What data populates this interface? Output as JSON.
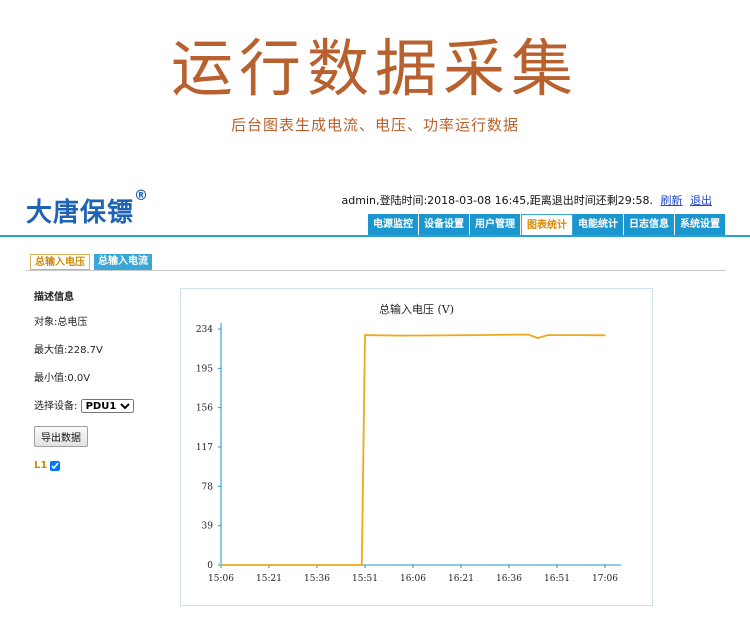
{
  "banner": {
    "title": "运行数据采集",
    "subtitle": "后台图表生成电流、电压、功率运行数据"
  },
  "app": {
    "logo_text": "大唐保镖",
    "logo_mark": "®",
    "userbar": {
      "status": "admin,登陆时间:2018-03-08 16:45,距离退出时间还剩29:58.",
      "refresh": "刷新",
      "logout": "退出"
    },
    "nav": [
      {
        "label": "电源监控",
        "active": false
      },
      {
        "label": "设备设置",
        "active": false
      },
      {
        "label": "用户管理",
        "active": false
      },
      {
        "label": "图表统计",
        "active": true
      },
      {
        "label": "电能统计",
        "active": false
      },
      {
        "label": "日志信息",
        "active": false
      },
      {
        "label": "系统设置",
        "active": false
      }
    ],
    "subtabs": [
      {
        "label": "总输入电压",
        "active": true
      },
      {
        "label": "总输入电流",
        "active": false
      }
    ],
    "side": {
      "heading": "描述信息",
      "object": "对象:总电压",
      "max": "最大值:228.7V",
      "min": "最小值:0.0V",
      "select_label": "选择设备:",
      "select_value": "PDU1",
      "export_button": "导出数据",
      "legend_label": "L1",
      "legend_checked": true
    },
    "colors": {
      "accent": "#1b96cf",
      "series": "#f0a818",
      "banner": "#b8612e"
    }
  },
  "chart_data": {
    "type": "line",
    "title": "总输入电压 (V)",
    "xlabel": "",
    "ylabel": "",
    "x_ticks": [
      "15:06",
      "15:21",
      "15:36",
      "15:51",
      "16:06",
      "16:21",
      "16:36",
      "16:51",
      "17:06"
    ],
    "x_range_minutes": [
      0,
      60
    ],
    "y_ticks": [
      0,
      39,
      78,
      117,
      156,
      195,
      234
    ],
    "ylim": [
      0,
      234
    ],
    "grid": false,
    "series": [
      {
        "name": "L1",
        "points": [
          {
            "x": 0,
            "y": 0
          },
          {
            "x": 22,
            "y": 0
          },
          {
            "x": 22.5,
            "y": 228
          },
          {
            "x": 28,
            "y": 227.5
          },
          {
            "x": 40,
            "y": 228
          },
          {
            "x": 48,
            "y": 228.5
          },
          {
            "x": 49.5,
            "y": 225
          },
          {
            "x": 51,
            "y": 228
          },
          {
            "x": 56,
            "y": 228
          },
          {
            "x": 60,
            "y": 227.8
          }
        ]
      }
    ]
  }
}
